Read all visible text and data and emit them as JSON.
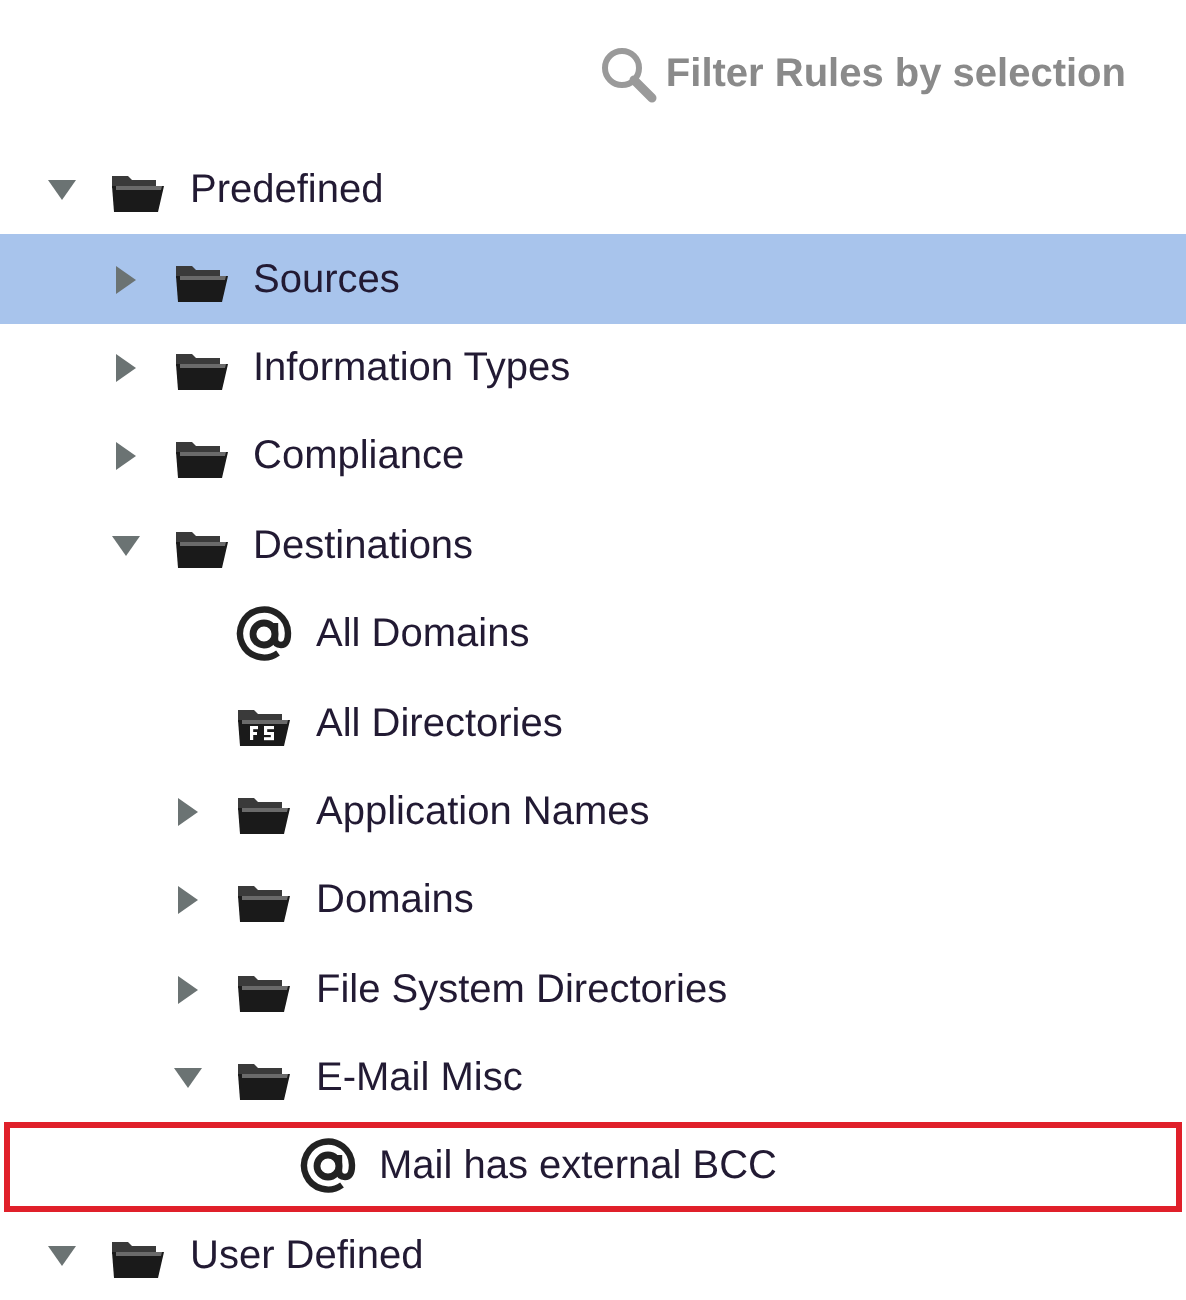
{
  "filter": {
    "label": "Filter Rules by selection"
  },
  "tree": [
    {
      "label": "Predefined",
      "kind": "folder",
      "expanded": true,
      "selected": false,
      "highlighted": false,
      "children": [
        {
          "label": "Sources",
          "kind": "folder",
          "expanded": false,
          "selected": true,
          "highlighted": false
        },
        {
          "label": "Information Types",
          "kind": "folder",
          "expanded": false,
          "selected": false,
          "highlighted": false
        },
        {
          "label": "Compliance",
          "kind": "folder",
          "expanded": false,
          "selected": false,
          "highlighted": false
        },
        {
          "label": "Destinations",
          "kind": "folder",
          "expanded": true,
          "selected": false,
          "highlighted": false,
          "children": [
            {
              "label": "All Domains",
              "kind": "email",
              "selected": false,
              "highlighted": false
            },
            {
              "label": "All Directories",
              "kind": "filesystem",
              "selected": false,
              "highlighted": false
            },
            {
              "label": "Application Names",
              "kind": "folder",
              "expanded": false,
              "selected": false,
              "highlighted": false
            },
            {
              "label": "Domains",
              "kind": "folder",
              "expanded": false,
              "selected": false,
              "highlighted": false
            },
            {
              "label": "File System Directories",
              "kind": "folder",
              "expanded": false,
              "selected": false,
              "highlighted": false
            },
            {
              "label": "E-Mail Misc",
              "kind": "folder",
              "expanded": true,
              "selected": false,
              "highlighted": false,
              "children": [
                {
                  "label": "Mail has external BCC",
                  "kind": "email",
                  "selected": false,
                  "highlighted": true
                }
              ]
            }
          ]
        }
      ]
    },
    {
      "label": "User Defined",
      "kind": "folder",
      "expanded": true,
      "selected": false,
      "highlighted": false
    }
  ]
}
